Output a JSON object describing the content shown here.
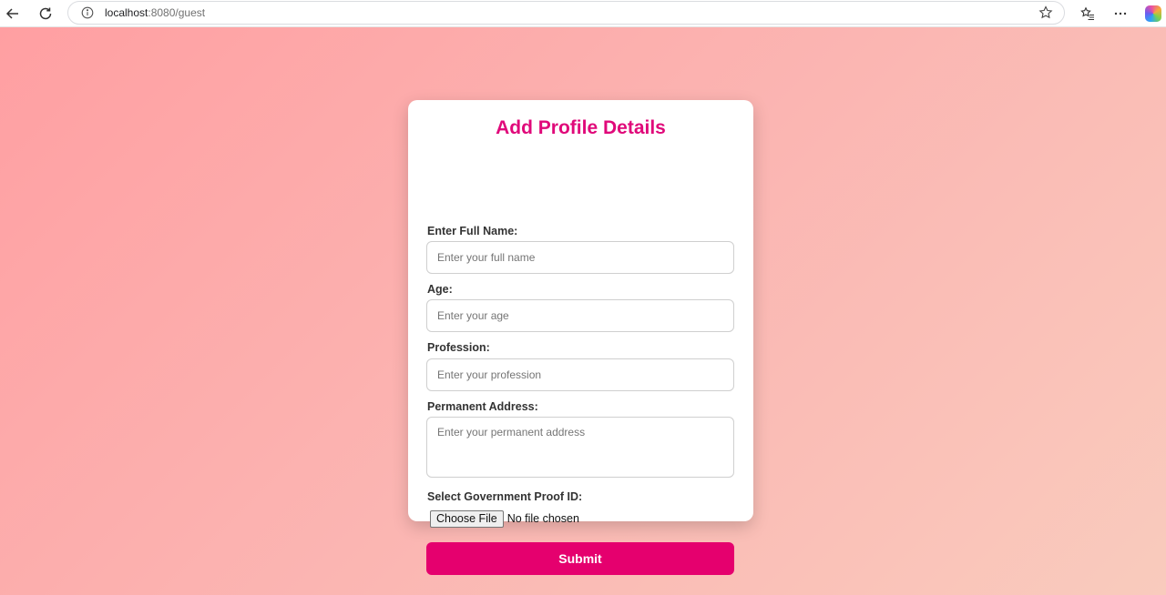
{
  "browser": {
    "url_host": "localhost",
    "url_path": ":8080/guest"
  },
  "form": {
    "title": "Add Profile Details",
    "full_name": {
      "label": "Enter Full Name:",
      "placeholder": "Enter your full name"
    },
    "age": {
      "label": "Age:",
      "placeholder": "Enter your age"
    },
    "profession": {
      "label": "Profession:",
      "placeholder": "Enter your profession"
    },
    "address": {
      "label": "Permanent Address:",
      "placeholder": "Enter your permanent address"
    },
    "proof": {
      "label": "Select Government Proof ID:",
      "button_label": "Choose File",
      "status": "No file chosen"
    },
    "submit_label": "Submit"
  },
  "colors": {
    "accent": "#e5006e",
    "title": "#e0097a"
  }
}
